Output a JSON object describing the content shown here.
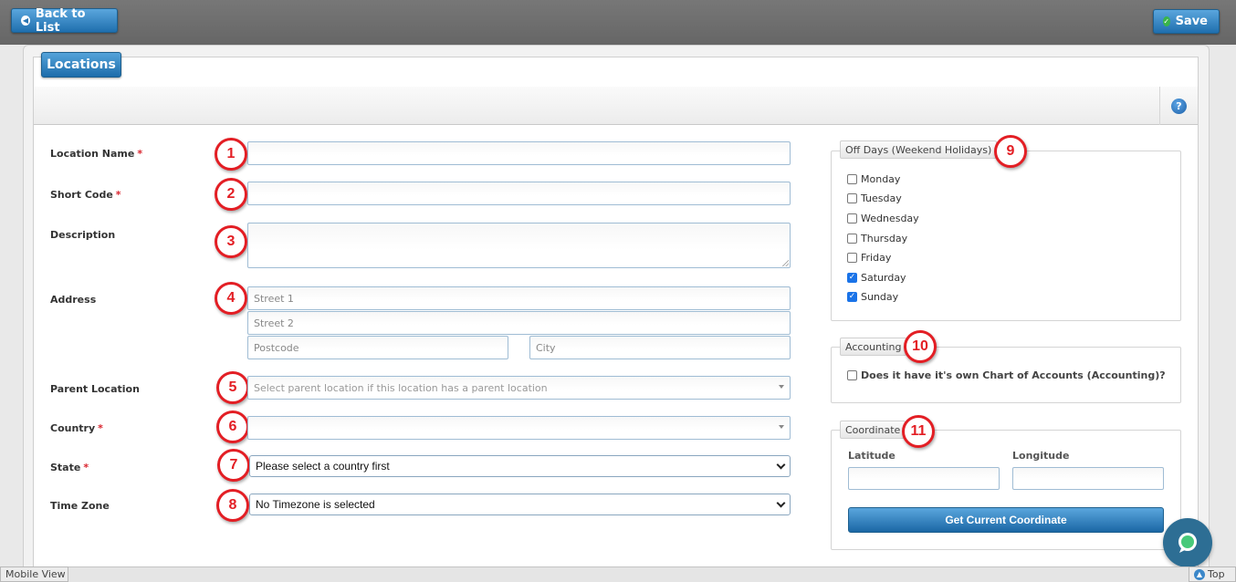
{
  "toolbar": {
    "back_label": "Back to List",
    "save_label": "Save"
  },
  "tab": {
    "label": "Locations"
  },
  "form": {
    "location_name": {
      "label": "Location Name",
      "required": "*",
      "value": "",
      "marker": "1"
    },
    "short_code": {
      "label": "Short Code",
      "required": "*",
      "value": "",
      "marker": "2"
    },
    "description": {
      "label": "Description",
      "value": "",
      "marker": "3"
    },
    "address": {
      "label": "Address",
      "marker": "4",
      "street1_placeholder": "Street 1",
      "street2_placeholder": "Street 2",
      "postcode_placeholder": "Postcode",
      "city_placeholder": "City"
    },
    "parent_location": {
      "label": "Parent Location",
      "placeholder": "Select parent location if this location has a parent location",
      "marker": "5"
    },
    "country": {
      "label": "Country",
      "required": "*",
      "value": "",
      "marker": "6"
    },
    "state": {
      "label": "State",
      "required": "*",
      "value": "Please select a country first",
      "marker": "7"
    },
    "time_zone": {
      "label": "Time Zone",
      "value": "No Timezone is selected",
      "marker": "8"
    }
  },
  "off_days": {
    "legend": "Off Days (Weekend Holidays)",
    "marker": "9",
    "days": [
      {
        "label": "Monday",
        "checked": false
      },
      {
        "label": "Tuesday",
        "checked": false
      },
      {
        "label": "Wednesday",
        "checked": false
      },
      {
        "label": "Thursday",
        "checked": false
      },
      {
        "label": "Friday",
        "checked": false
      },
      {
        "label": "Saturday",
        "checked": true
      },
      {
        "label": "Sunday",
        "checked": true
      }
    ]
  },
  "accounting": {
    "legend": "Accounting",
    "marker": "10",
    "question": "Does it have it's own Chart of Accounts (Accounting)?",
    "checked": false
  },
  "coordinates": {
    "legend": "Coordinate",
    "marker": "11",
    "latitude_label": "Latitude",
    "longitude_label": "Longitude",
    "button_label": "Get Current Coordinate"
  },
  "footer": {
    "mobile_view": "Mobile View",
    "top": "Top"
  },
  "icons": [
    "back-arrow-icon",
    "check-icon",
    "help-icon",
    "chat-icon",
    "up-arrow-icon"
  ],
  "colors": {
    "accent": "#1f6fae",
    "marker_red": "#e31e24",
    "required": "#d9232d",
    "chat": "#2d6e94"
  }
}
